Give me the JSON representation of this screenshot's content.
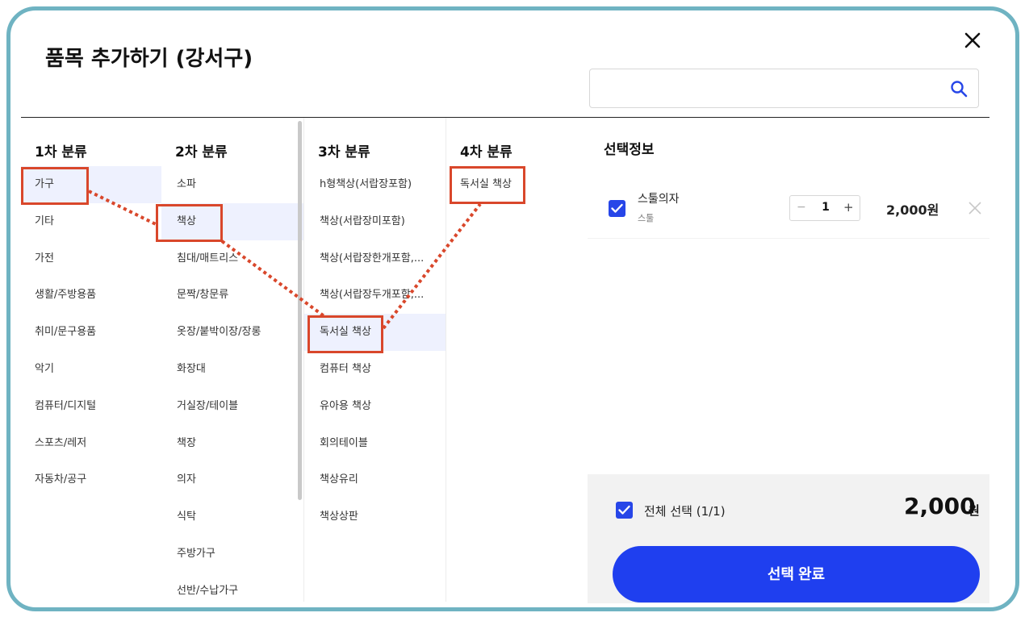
{
  "dialog": {
    "title": "품목 추가하기 (강서구)",
    "search_placeholder": ""
  },
  "columns": [
    {
      "header": "1차 분류",
      "items": [
        "가구",
        "기타",
        "가전",
        "생활/주방용품",
        "취미/문구용품",
        "악기",
        "컴퓨터/디지털",
        "스포츠/레저",
        "자동차/공구"
      ],
      "selected_index": 0
    },
    {
      "header": "2차 분류",
      "items": [
        "소파",
        "책상",
        "침대/매트리스",
        "문짝/창문류",
        "옷장/붙박이장/장롱",
        "화장대",
        "거실장/테이블",
        "책장",
        "의자",
        "식탁",
        "주방가구",
        "선반/수납가구"
      ],
      "selected_index": 1
    },
    {
      "header": "3차 분류",
      "items": [
        "h형책상(서랍장포함)",
        "책상(서랍장미포함)",
        "책상(서랍장한개포함,...",
        "책상(서랍장두개포함,...",
        "독서실 책상",
        "컴퓨터 책상",
        "유아용 책상",
        "회의테이블",
        "책상유리",
        "책상상판"
      ],
      "selected_index": 4
    },
    {
      "header": "4차 분류",
      "items": [
        "독서실 책상"
      ],
      "selected_index": null
    }
  ],
  "selection_panel": {
    "title": "선택정보",
    "items": [
      {
        "name": "스툴의자",
        "category": "스툴",
        "quantity": "1",
        "minus": "−",
        "plus": "+",
        "price": "2,000원",
        "checked": true
      }
    ],
    "select_all_label": "전체 선택 (1/1)",
    "total": "2,000",
    "total_unit": "원",
    "complete_button": "선택 완료"
  },
  "colors": {
    "accent": "#1f3fef",
    "checkbox": "#2746e8",
    "highlight_annotation": "#d9472b",
    "frame_border": "#6fb3c2",
    "selected_row_bg": "#eef1fe"
  },
  "icons": {
    "close": "close-icon",
    "search": "search-icon",
    "remove": "remove-icon",
    "check": "check-icon"
  }
}
